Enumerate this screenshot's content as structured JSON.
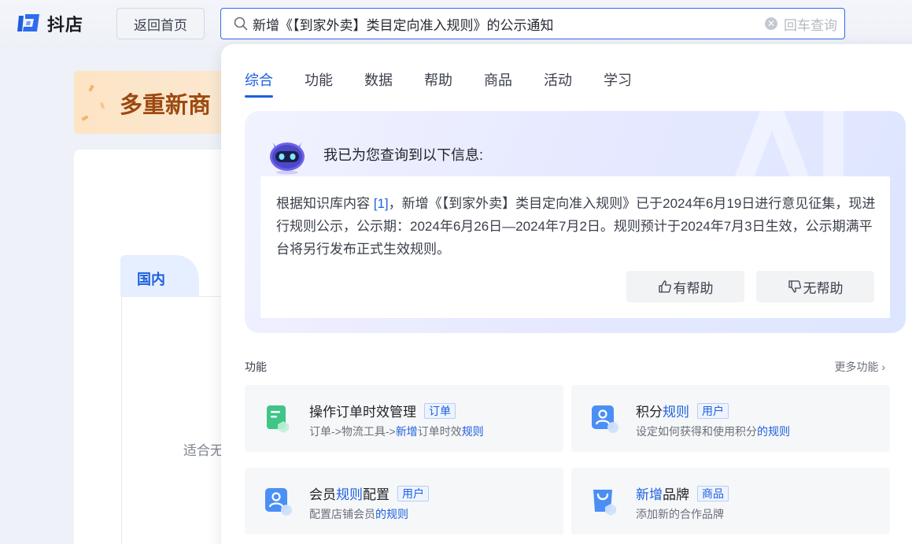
{
  "app": {
    "name": "抖店"
  },
  "header": {
    "home_button": "返回首页",
    "search_value": "新增《【到家外卖】类目定向准入规则》的公示通知",
    "enter_hint": "回车查询"
  },
  "background": {
    "banner_text": "多重新商",
    "region_tab": "国内",
    "fit_text": "适合无"
  },
  "tabs": [
    "综合",
    "功能",
    "数据",
    "帮助",
    "商品",
    "活动",
    "学习"
  ],
  "ai_answer": {
    "intro": "我已为您查询到以下信息:",
    "text_before_ref": "根据知识库内容 ",
    "ref": "[1]",
    "text_after_ref": "，新增《【到家外卖】类目定向准入规则》已于2024年6月19日进行意见征集，现进行规则公示，公示期：2024年6月26日—2024年7月2日。规则预计于2024年7月3日生效，公示期满平台将另行发布正式生效规则。",
    "helpful": "有帮助",
    "not_helpful": "无帮助"
  },
  "functions_section": {
    "title": "功能",
    "more": "更多功能",
    "items": [
      {
        "title": "操作订单时效管理",
        "tag": "订单",
        "desc_a": "订单->物流工具->",
        "desc_hl1": "新增",
        "desc_b": "订单时效",
        "desc_hl2": "规则",
        "icon": "order-doc-icon",
        "color": "#3fc586"
      },
      {
        "title_a": "积分",
        "title_hl": "规则",
        "title_b": "",
        "tag": "用户",
        "desc_a": "设定如何获得和使用积分",
        "desc_hl1": "的规则",
        "icon": "user-badge-icon",
        "color": "#4a8ff5"
      },
      {
        "title_a": "会员",
        "title_hl": "规则",
        "title_b": "配置",
        "tag": "用户",
        "desc_a": "配置店铺会员",
        "desc_hl1": "的规则",
        "icon": "user-badge-icon",
        "color": "#4a8ff5"
      },
      {
        "title_hl": "新增",
        "title_b": "品牌",
        "tag": "商品",
        "desc_a": "添加新的合作品牌",
        "icon": "shopping-bag-icon",
        "color": "#4a8ff5"
      }
    ]
  }
}
